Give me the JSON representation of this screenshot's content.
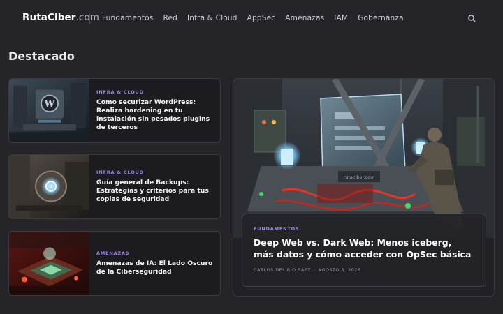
{
  "site": {
    "logo_name": "RutaCiber",
    "logo_tld": ".com"
  },
  "nav": [
    {
      "label": "Fundamentos"
    },
    {
      "label": "Red"
    },
    {
      "label": "Infra & Cloud"
    },
    {
      "label": "AppSec"
    },
    {
      "label": "Amenazas"
    },
    {
      "label": "IAM"
    },
    {
      "label": "Gobernanza"
    }
  ],
  "icons": {
    "search": "search-icon"
  },
  "colors": {
    "background": "#252428",
    "card": "#1c1b1f",
    "accent": "#a084ee",
    "text": "#f4f4f7",
    "muted": "#9a99a3"
  },
  "section": {
    "title": "Destacado"
  },
  "cards": [
    {
      "category": "Infra & Cloud",
      "title": "Como securizar WordPress: Realiza hardening en tu instalación sin pesados plugins de terceros",
      "image": "server-room-wordpress-illustration"
    },
    {
      "category": "Infra & Cloud",
      "title": "Guía general de Backups: Estrategias y criterios para tus copias de seguridad",
      "image": "backup-vault-illustration"
    },
    {
      "category": "Amenazas",
      "title": "Amenazas de IA: El Lado Oscuro de la Ciberseguridad",
      "image": "ai-chip-red-illustration"
    }
  ],
  "featured": {
    "category": "Fundamentos",
    "title": "Deep Web vs. Dark Web: Menos iceberg, más datos y cómo acceder con OpSec básica",
    "author": "Carlos del Río Sáez",
    "date": "Agosto 3, 2026",
    "image": "hacker-lab-console-illustration",
    "image_caption": "rutaciber.com"
  }
}
